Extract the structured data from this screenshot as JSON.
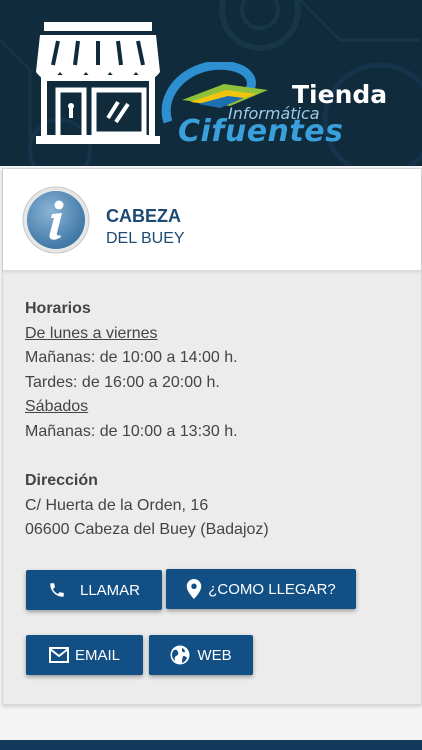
{
  "header": {
    "logo_top_text": "Informática",
    "logo_main_text": "Cifuentes",
    "logo_side_text": "Tienda",
    "colors": {
      "background": "#0f2b3c",
      "accent": "#3aa0dc"
    }
  },
  "store": {
    "title_main": "CABEZA",
    "title_sub": "DEL BUEY",
    "icon": "info-icon"
  },
  "schedule": {
    "heading": "Horarios",
    "weekdays_label": "De lunes a viernes",
    "weekdays_morning": "Mañanas: de 10:00 a 14:00 h.",
    "weekdays_afternoon": "Tardes: de 16:00 a 20:00 h.",
    "saturday_label": "Sábados",
    "saturday_morning": "Mañanas: de 10:00 a 13:30 h."
  },
  "address": {
    "heading": "Dirección",
    "line1": "C/ Huerta de la Orden, 16",
    "line2": "06600 Cabeza del Buey (Badajoz)"
  },
  "buttons": {
    "call": {
      "label": "LLAMAR",
      "icon": "phone-icon"
    },
    "directions": {
      "label": "¿COMO LLEGAR?",
      "icon": "map-pin-icon"
    },
    "email": {
      "label": "EMAIL",
      "icon": "mail-icon"
    },
    "web": {
      "label": "WEB",
      "icon": "globe-icon"
    }
  },
  "colors": {
    "button": "#114f85",
    "title": "#1d4a73",
    "card": "#ececec"
  }
}
